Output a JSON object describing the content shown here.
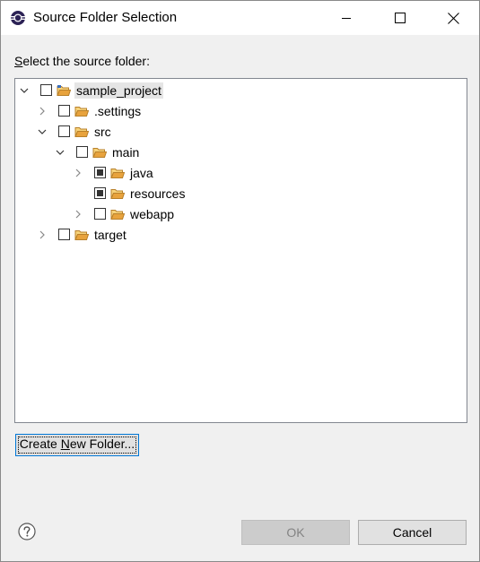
{
  "window": {
    "title": "Source Folder Selection",
    "icon": "eclipse-icon",
    "controls": [
      "minimize-icon",
      "maximize-icon",
      "close-icon"
    ]
  },
  "prompt": {
    "mnemonic": "S",
    "rest": "elect the source folder:"
  },
  "tree": {
    "items": [
      {
        "label": "sample_project",
        "depth": 0,
        "expanded": true,
        "twisty": true,
        "check": "unchecked",
        "icon": "project-folder-icon",
        "selected": true
      },
      {
        "label": ".settings",
        "depth": 1,
        "expanded": false,
        "twisty": true,
        "check": "unchecked",
        "icon": "folder-icon"
      },
      {
        "label": "src",
        "depth": 1,
        "expanded": true,
        "twisty": true,
        "check": "unchecked",
        "icon": "folder-icon"
      },
      {
        "label": "main",
        "depth": 2,
        "expanded": true,
        "twisty": true,
        "check": "unchecked",
        "icon": "folder-icon"
      },
      {
        "label": "java",
        "depth": 3,
        "expanded": false,
        "twisty": true,
        "check": "grayed",
        "icon": "folder-icon"
      },
      {
        "label": "resources",
        "depth": 3,
        "expanded": false,
        "twisty": false,
        "check": "grayed",
        "icon": "folder-icon"
      },
      {
        "label": "webapp",
        "depth": 3,
        "expanded": false,
        "twisty": true,
        "check": "unchecked",
        "icon": "folder-icon"
      },
      {
        "label": "target",
        "depth": 1,
        "expanded": false,
        "twisty": true,
        "check": "unchecked",
        "icon": "folder-icon"
      }
    ]
  },
  "buttons": {
    "create_pre": "Create ",
    "create_mnemonic": "N",
    "create_post": "ew Folder...",
    "ok": "OK",
    "cancel": "Cancel",
    "ok_enabled": false,
    "help_icon": "help-icon"
  },
  "colors": {
    "folder": "#e8a33d",
    "selection": "#e5e5e5",
    "focus": "#0078d7",
    "disabled_text": "#838383"
  }
}
